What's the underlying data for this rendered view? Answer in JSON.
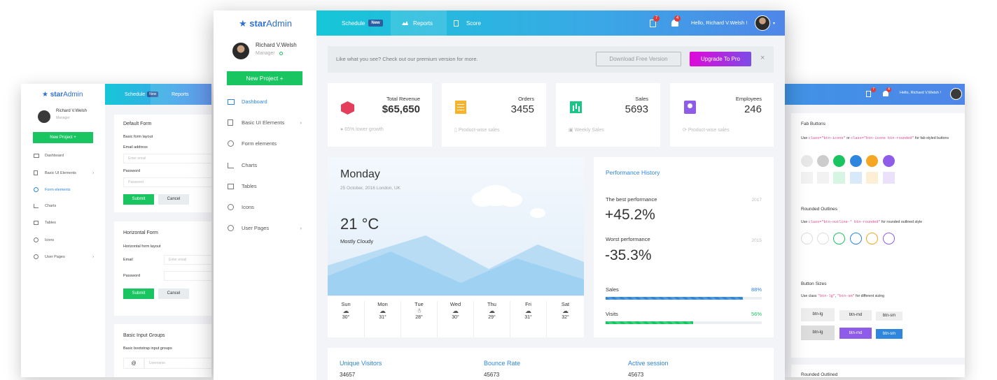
{
  "brand": {
    "star": "star",
    "admin": "Admin"
  },
  "user": {
    "name": "Richard V.Welsh",
    "role": "Manager",
    "greeting": "Hello, Richard V.Welsh !"
  },
  "topnav": {
    "schedule": "Schedule",
    "new_badge": "New",
    "reports": "Reports",
    "score": "Score",
    "badge1": "7",
    "badge2": "4"
  },
  "sidebar": {
    "new_project": "New Project +",
    "items": [
      "Dashboard",
      "Basic UI Elements",
      "Form elements",
      "Charts",
      "Tables",
      "Icons",
      "User Pages"
    ]
  },
  "banner": {
    "text": "Like what you see? Check out our premium version for more.",
    "download": "Download Free Version",
    "upgrade": "Upgrade To Pro",
    "close": "×"
  },
  "stats": [
    {
      "label": "Total Revenue",
      "value": "$65,650",
      "foot": "65% lower growth",
      "color": "#e53e5c"
    },
    {
      "label": "Orders",
      "value": "3455",
      "foot": "Product-wise sales",
      "color": "#f7b32b"
    },
    {
      "label": "Sales",
      "value": "5693",
      "foot": "Weekly Sales",
      "color": "#19c587"
    },
    {
      "label": "Employees",
      "value": "246",
      "foot": "Product-wise sales",
      "color": "#8e5ce8"
    }
  ],
  "weather": {
    "day": "Monday",
    "date": "25 October, 2016 London, UK",
    "temp": "21 °C",
    "cond": "Mostly Cloudy",
    "days": [
      {
        "d": "Sun",
        "t": "30°"
      },
      {
        "d": "Mon",
        "t": "31°"
      },
      {
        "d": "Tue",
        "t": "28°"
      },
      {
        "d": "Wed",
        "t": "30°"
      },
      {
        "d": "Thu",
        "t": "29°"
      },
      {
        "d": "Fri",
        "t": "31°"
      },
      {
        "d": "Sat",
        "t": "32°"
      }
    ]
  },
  "performance": {
    "title": "Performance History",
    "best_label": "The best performance",
    "best_year": "2017",
    "best_value": "+45.2%",
    "worst_label": "Worst performance",
    "worst_year": "2015",
    "worst_value": "-35.3%",
    "sales_label": "Sales",
    "sales_pct": "88%",
    "sales_val": 0.88,
    "visits_label": "Visits",
    "visits_pct": "56%",
    "visits_val": 0.56
  },
  "bottom": {
    "unique": "Unique Visitors",
    "unique_val": "34657",
    "bounce": "Bounce Rate",
    "bounce_val": "45673",
    "active": "Active session",
    "active_val": "45673"
  },
  "left_forms": {
    "default_title": "Default Form",
    "default_sub": "Basic form layout",
    "email_label": "Email address",
    "email_ph": "Enter email",
    "password_label": "Password",
    "password_ph": "Password",
    "submit": "Submit",
    "cancel": "Cancel",
    "horizontal_title": "Horizontal Form",
    "horizontal_sub": "Horizontal form layout",
    "h_email": "Email",
    "h_email_ph": "Enter email",
    "h_password": "Password",
    "input_title": "Basic Input Groups",
    "input_sub": "Basic bootstrap input groups",
    "at": "@",
    "username_ph": "Username"
  },
  "right_buttons": {
    "fab_title": "Fab Buttons",
    "fab_desc_pre": "Use",
    "fab_code1": "class=\"btn-icons\"",
    "fab_or": "or",
    "fab_code2": "class=\"btn-icons btn-rounded\"",
    "fab_desc_post": "for fab styled buttons",
    "outline_title": "Rounded Outlines",
    "outline_pre": "Use",
    "outline_code": "class=\"btn-outline-* btn-rounded\"",
    "outline_post": "for rounded outlined style",
    "sizes_title": "Button Sizes",
    "sizes_pre": "Use class",
    "sizes_code1": "\"btn-lg\"",
    "sizes_comma": ",",
    "sizes_code2": "\"btn-sm\"",
    "sizes_post": "for different sizing",
    "lg": "btn-lg",
    "md": "btn-md",
    "sm": "btn-sm",
    "bottom_title": "Rounded Outlined"
  }
}
